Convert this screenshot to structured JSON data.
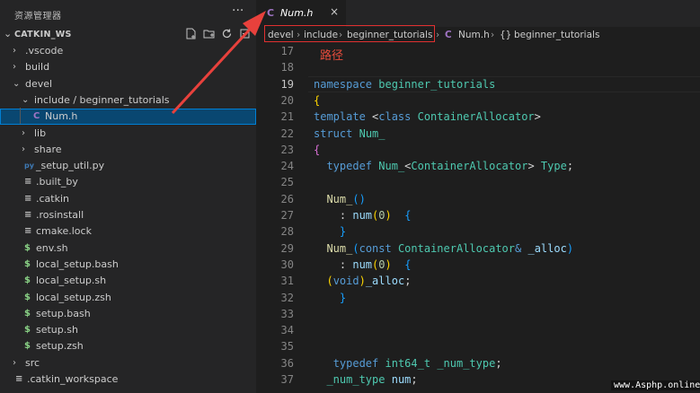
{
  "sidebar": {
    "title": "资源管理器",
    "more": "···",
    "workspace": "CATKIN_WS",
    "tree": [
      {
        "label": ".vscode",
        "kind": "folder",
        "expanded": false,
        "depth": 1
      },
      {
        "label": "build",
        "kind": "folder",
        "expanded": false,
        "depth": 1
      },
      {
        "label": "devel",
        "kind": "folder",
        "expanded": true,
        "depth": 1
      },
      {
        "label": "include / beginner_tutorials",
        "kind": "folder",
        "expanded": true,
        "depth": 2
      },
      {
        "label": "Num.h",
        "kind": "c",
        "icon": "C",
        "depth": 3,
        "selected": true
      },
      {
        "label": "lib",
        "kind": "folder",
        "expanded": false,
        "depth": 2
      },
      {
        "label": "share",
        "kind": "folder",
        "expanded": false,
        "depth": 2
      },
      {
        "label": "_setup_util.py",
        "kind": "py",
        "icon": "py",
        "depth": 2
      },
      {
        "label": ".built_by",
        "kind": "text",
        "icon": "≡",
        "depth": 2
      },
      {
        "label": ".catkin",
        "kind": "text",
        "icon": "≡",
        "depth": 2
      },
      {
        "label": ".rosinstall",
        "kind": "text",
        "icon": "≡",
        "depth": 2
      },
      {
        "label": "cmake.lock",
        "kind": "text",
        "icon": "≡",
        "depth": 2
      },
      {
        "label": "env.sh",
        "kind": "sh",
        "icon": "$",
        "depth": 2
      },
      {
        "label": "local_setup.bash",
        "kind": "sh",
        "icon": "$",
        "depth": 2
      },
      {
        "label": "local_setup.sh",
        "kind": "sh",
        "icon": "$",
        "depth": 2
      },
      {
        "label": "local_setup.zsh",
        "kind": "sh",
        "icon": "$",
        "depth": 2
      },
      {
        "label": "setup.bash",
        "kind": "sh",
        "icon": "$",
        "depth": 2
      },
      {
        "label": "setup.sh",
        "kind": "sh",
        "icon": "$",
        "depth": 2
      },
      {
        "label": "setup.zsh",
        "kind": "sh",
        "icon": "$",
        "depth": 2
      },
      {
        "label": "src",
        "kind": "folder",
        "expanded": false,
        "depth": 1
      },
      {
        "label": ".catkin_workspace",
        "kind": "text",
        "icon": "≡",
        "depth": 1
      }
    ]
  },
  "editor": {
    "tab": {
      "icon": "C",
      "label": "Num.h",
      "close": "×"
    },
    "breadcrumb": {
      "items": [
        "devel",
        "include",
        "beginner_tutorials"
      ],
      "file_icon": "C",
      "file": "Num.h",
      "symbol_icon": "{}",
      "symbol": "beginner_tutorials"
    },
    "annotation": "路径",
    "active_line": 19,
    "line_numbers": [
      17,
      18,
      19,
      20,
      21,
      22,
      23,
      24,
      25,
      26,
      27,
      28,
      29,
      30,
      31,
      32,
      33,
      34,
      35,
      36,
      37
    ]
  },
  "watermark": "www.Asphp.online",
  "colors": {
    "sidebar_bg": "#252526",
    "editor_bg": "#1e1e1e",
    "selection_bg": "#094771",
    "annotation_red": "#e74c3c",
    "keyword_blue": "#569cd6",
    "type_teal": "#4ec9b0"
  }
}
